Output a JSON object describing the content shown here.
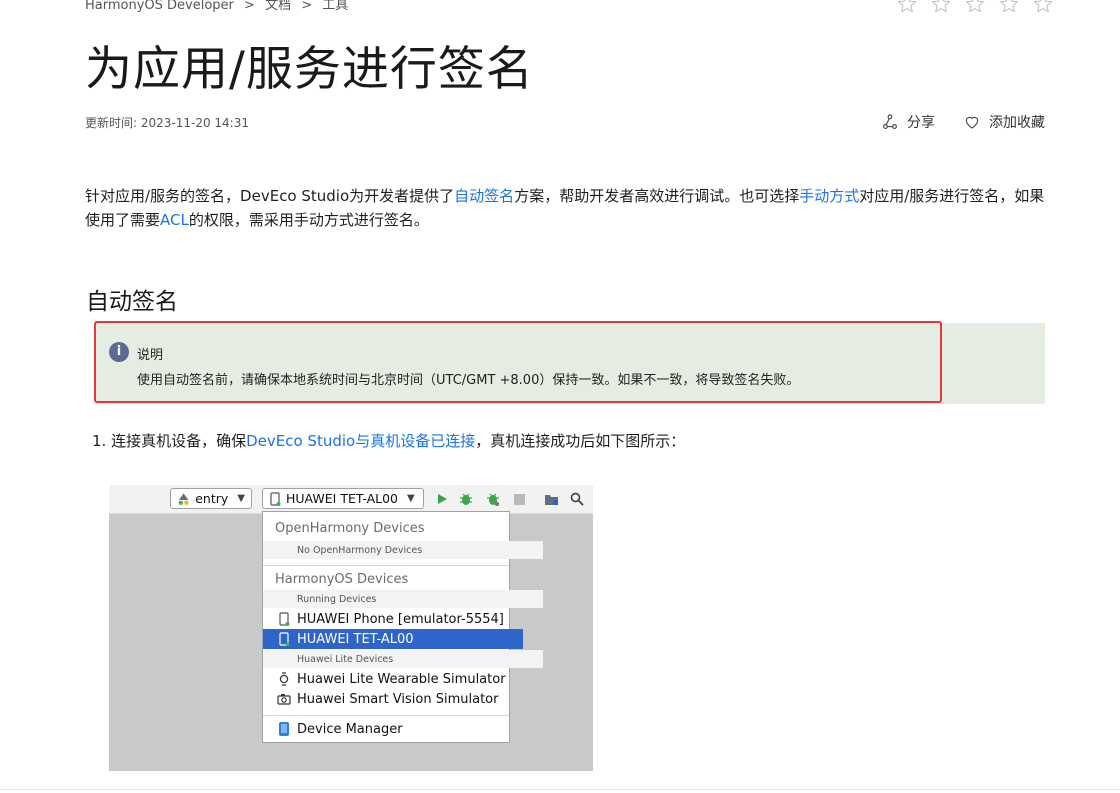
{
  "breadcrumb": {
    "items": [
      "HarmonyOS Developer",
      ">",
      "文档",
      ">",
      "工具"
    ]
  },
  "page": {
    "title": "为应用/服务进行签名",
    "updated": "更新时间: 2023-11-20 14:31",
    "share_label": "分享",
    "favorite_label": "添加收藏"
  },
  "intro": {
    "p1": "针对应用/服务的签名，DevEco Studio为开发者提供了",
    "link1": "自动签名",
    "p2": "方案，帮助开发者高效进行调试。也可选择",
    "link2": "手动方式",
    "p3": "对应用/服务进行签名，如果使用了需要",
    "link3": "ACL",
    "p4": "的权限，需采用手动方式进行签名。"
  },
  "section": {
    "heading": "自动签名"
  },
  "note": {
    "icon_text": "i",
    "title": "说明",
    "body": "使用自动签名前，请确保本地系统时间与北京时间（UTC/GMT +8.00）保持一致。如果不一致，将导致签名失败。"
  },
  "step1": {
    "prefix": "1. 连接真机设备，确保",
    "link": "DevEco Studio与真机设备已连接",
    "suffix": "，真机连接成功后如下图所示："
  },
  "ide": {
    "module_combo": "entry",
    "device_combo": "HUAWEI TET-AL00",
    "dropdown": {
      "group1": "OpenHarmony Devices",
      "group1_sub": "No OpenHarmony Devices",
      "group2": "HarmonyOS Devices",
      "group2_sub": "Running Devices",
      "item_phone": "HUAWEI Phone [emulator-5554]",
      "item_tet": "HUAWEI TET-AL00",
      "sub_lite": "Huawei Lite Devices",
      "item_wearable": "Huawei Lite Wearable Simulator",
      "item_vision": "Huawei Smart Vision Simulator",
      "item_manager": "Device Manager"
    }
  },
  "colors": {
    "link": "#1a73e8",
    "note_bg": "#e5ede2",
    "highlight_border": "#e53935",
    "selected_row": "#2f65ca"
  }
}
